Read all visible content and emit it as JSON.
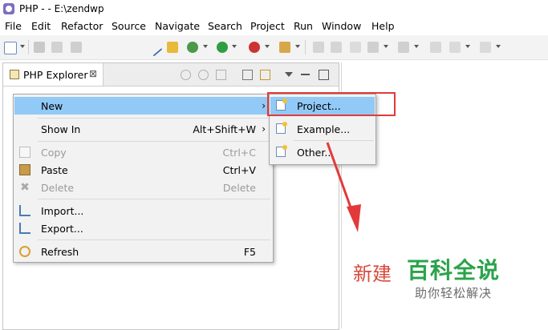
{
  "window": {
    "title": "PHP -  - E:\\zendwp"
  },
  "menubar": {
    "items": [
      "File",
      "Edit",
      "Refactor",
      "Source",
      "Navigate",
      "Search",
      "Project",
      "Run",
      "Window",
      "Help"
    ]
  },
  "explorer": {
    "tab_label": "PHP Explorer",
    "close_glyph": "⊠"
  },
  "context_menu": {
    "items": [
      {
        "label": "New",
        "shortcut": "",
        "submenu": true,
        "state": "highlighted",
        "icon": "none"
      },
      {
        "label": "Show In",
        "shortcut": "Alt+Shift+W",
        "submenu": true,
        "state": "normal",
        "icon": "none"
      },
      {
        "label": "Copy",
        "shortcut": "Ctrl+C",
        "submenu": false,
        "state": "disabled",
        "icon": "copy-icon"
      },
      {
        "label": "Paste",
        "shortcut": "Ctrl+V",
        "submenu": false,
        "state": "normal",
        "icon": "paste-icon"
      },
      {
        "label": "Delete",
        "shortcut": "Delete",
        "submenu": false,
        "state": "disabled",
        "icon": "delete-icon"
      },
      {
        "label": "Import...",
        "shortcut": "",
        "submenu": false,
        "state": "normal",
        "icon": "import-icon"
      },
      {
        "label": "Export...",
        "shortcut": "",
        "submenu": false,
        "state": "normal",
        "icon": "export-icon"
      },
      {
        "label": "Refresh",
        "shortcut": "F5",
        "submenu": false,
        "state": "normal",
        "icon": "refresh-icon"
      }
    ],
    "submenu_arrow": "›"
  },
  "new_submenu": {
    "items": [
      {
        "label": "Project...",
        "state": "highlighted"
      },
      {
        "label": "Example...",
        "state": "normal"
      },
      {
        "label": "Other...",
        "state": "normal"
      }
    ]
  },
  "annotation": {
    "highlight_color": "#e23a3a",
    "arrow_color": "#e23a3a"
  },
  "watermark": {
    "left_text": "新建",
    "brand": "百科全说",
    "slogan": "助你轻松解决"
  },
  "colors": {
    "menu_highlight": "#91c9f7",
    "menu_bg": "#f2f2f2"
  }
}
